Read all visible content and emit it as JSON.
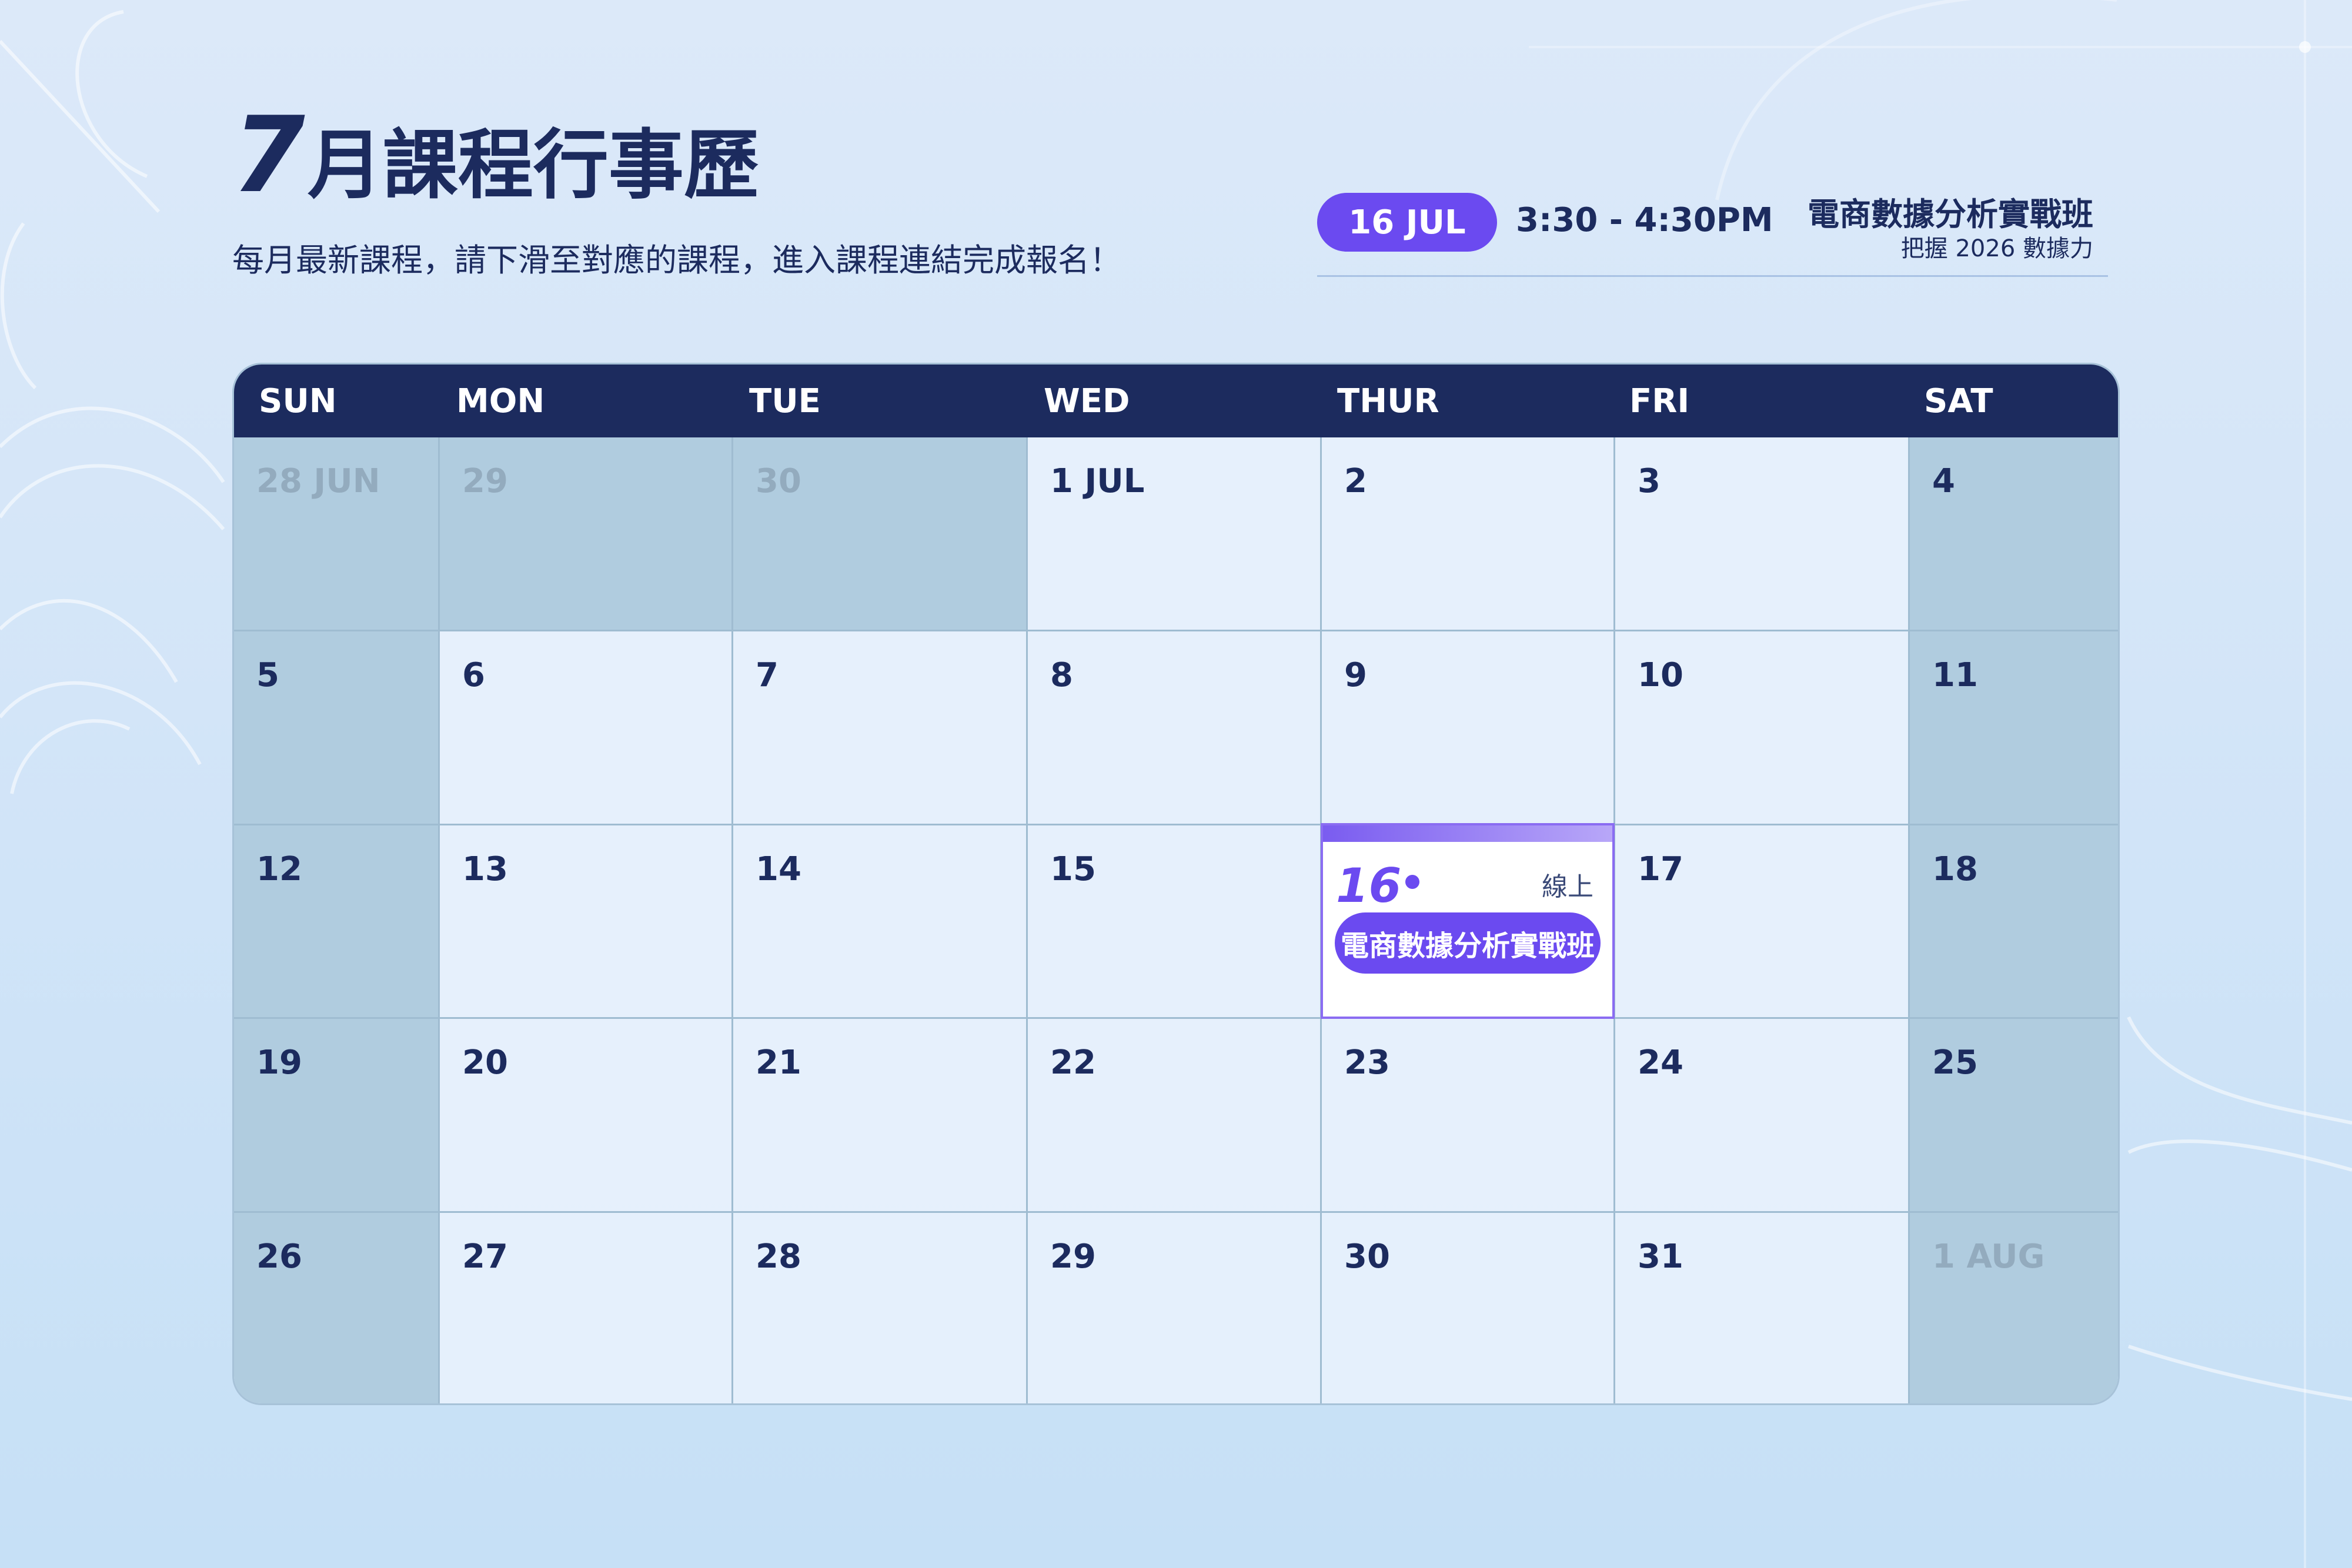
{
  "header": {
    "title_number": "7",
    "title_text": "月課程行事歷",
    "subtitle": "每月最新課程，請下滑至對應的課程，進入課程連結完成報名！"
  },
  "event_summary": {
    "date": "16 JUL",
    "time": "3:30 - 4:30PM",
    "course": "電商數據分析實戰班",
    "course_sub": "把握 2026 數據力"
  },
  "calendar": {
    "day_names": [
      "SUN",
      "MON",
      "TUE",
      "WED",
      "THUR",
      "FRI",
      "SAT"
    ],
    "weeks": [
      [
        "28 JUN",
        "29",
        "30",
        "1 JUL",
        "2",
        "3",
        "4"
      ],
      [
        "5",
        "6",
        "7",
        "8",
        "9",
        "10",
        "11"
      ],
      [
        "12",
        "13",
        "14",
        "15",
        "16",
        "17",
        "18"
      ],
      [
        "19",
        "20",
        "21",
        "22",
        "23",
        "24",
        "25"
      ],
      [
        "26",
        "27",
        "28",
        "29",
        "30",
        "31",
        "1 AUG"
      ]
    ],
    "event": {
      "day": "16",
      "mode": "線上",
      "course": "電商數據分析實戰班"
    }
  },
  "colors": {
    "navy": "#1c2b5e",
    "accent_purple": "#6b4af0",
    "weekend_fill": "#b0ccdf"
  }
}
